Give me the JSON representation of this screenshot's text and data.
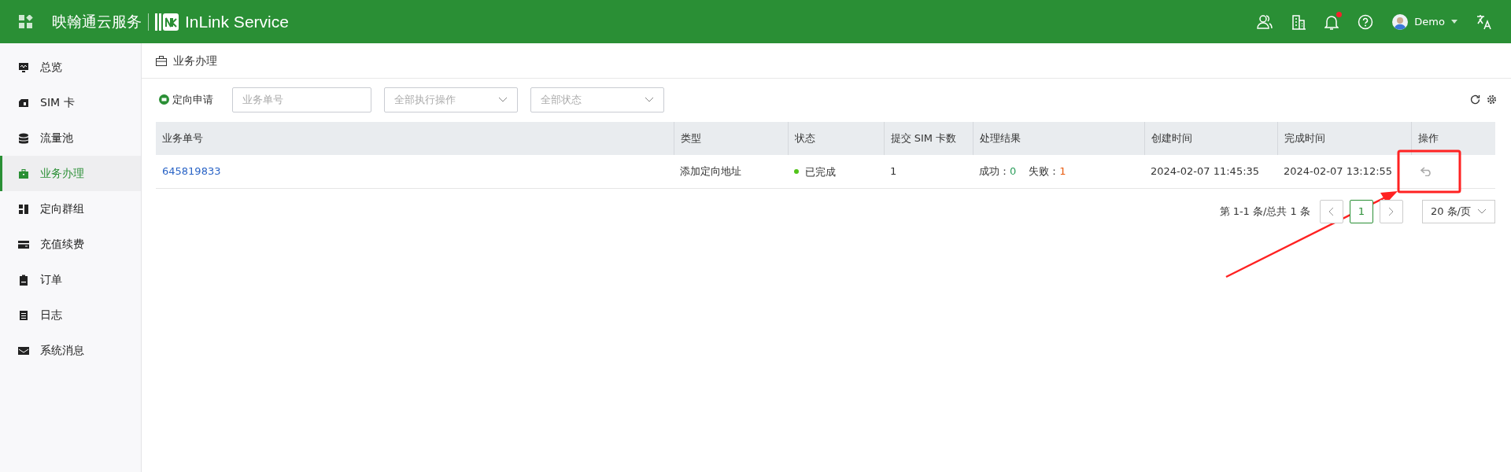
{
  "header": {
    "brand_cn": "映翰通云服务",
    "brand_en": "InLink Service",
    "notification_dot": true,
    "user_name": "Demo"
  },
  "sidebar": {
    "items": [
      {
        "label": "总览",
        "selected": false
      },
      {
        "label": "SIM 卡",
        "selected": false
      },
      {
        "label": "流量池",
        "selected": false
      },
      {
        "label": "业务办理",
        "selected": true
      },
      {
        "label": "定向群组",
        "selected": false
      },
      {
        "label": "充值续费",
        "selected": false
      },
      {
        "label": "订单",
        "selected": false
      },
      {
        "label": "日志",
        "selected": false
      },
      {
        "label": "系统消息",
        "selected": false
      }
    ]
  },
  "page_title": "业务办理",
  "toolbar": {
    "apply_button": "定向申请",
    "search": {
      "placeholder": "业务单号"
    },
    "selects": [
      {
        "placeholder": "全部执行操作"
      },
      {
        "placeholder": "全部状态"
      }
    ]
  },
  "table": {
    "columns": [
      "业务单号",
      "类型",
      "状态",
      "提交 SIM 卡数",
      "处理结果",
      "创建时间",
      "完成时间",
      "操作"
    ],
    "rows": [
      {
        "order_no": "645819833",
        "type": "添加定向地址",
        "status": {
          "label": "已完成",
          "color": "#52c41a"
        },
        "sim_count": "1",
        "result": {
          "success_label": "成功：",
          "success_value": "0",
          "fail_label": "失败：",
          "fail_value": "1"
        },
        "created": "2024-02-07 11:45:35",
        "completed": "2024-02-07 13:12:55"
      }
    ]
  },
  "pagination": {
    "summary": "第 1-1 条/总共 1 条",
    "pages": [
      {
        "label": "1",
        "selected": true
      }
    ],
    "page_size": "20 条/页"
  }
}
